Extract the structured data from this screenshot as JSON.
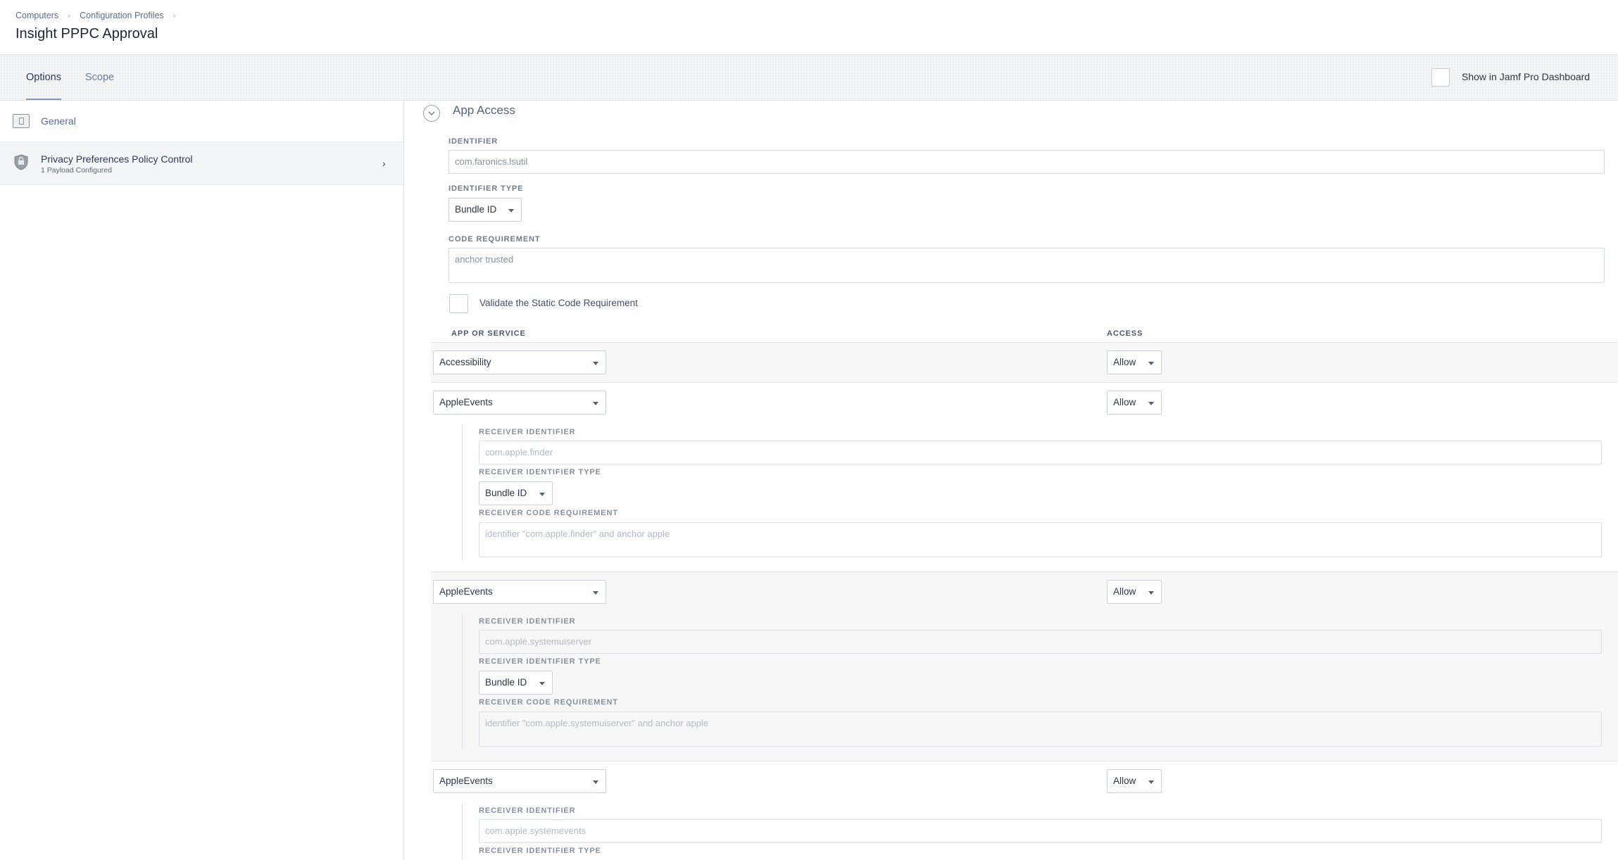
{
  "breadcrumb": [
    "Computers",
    "Configuration Profiles"
  ],
  "page_title": "Insight PPPC Approval",
  "tabs": {
    "options": "Options",
    "scope": "Scope"
  },
  "dashboard_label": "Show in Jamf Pro Dashboard",
  "sidebar": {
    "general": "General",
    "pppc": {
      "label": "Privacy Preferences Policy Control",
      "sub": "1 Payload Configured"
    }
  },
  "section": {
    "title": "App Access",
    "identifier_label": "IDENTIFIER",
    "identifier_value": "com.faronics.lsutil",
    "identifier_type_label": "IDENTIFIER TYPE",
    "identifier_type_value": "Bundle ID",
    "code_req_label": "CODE REQUIREMENT",
    "code_req_value": "anchor trusted",
    "validate_label": "Validate the Static Code Requirement",
    "col_app": "APP OR SERVICE",
    "col_access": "ACCESS"
  },
  "receiver_labels": {
    "identifier": "RECEIVER IDENTIFIER",
    "type": "RECEIVER IDENTIFIER TYPE",
    "code": "RECEIVER CODE REQUIREMENT"
  },
  "rows": [
    {
      "service": "Accessibility",
      "access": "Allow"
    },
    {
      "service": "AppleEvents",
      "access": "Allow",
      "receiver_id": "com.apple.finder",
      "receiver_type": "Bundle ID",
      "receiver_code": "identifier \"com.apple.finder\" and anchor apple"
    },
    {
      "service": "AppleEvents",
      "access": "Allow",
      "receiver_id": "com.apple.systemuiserver",
      "receiver_type": "Bundle ID",
      "receiver_code": "identifier \"com.apple.systemuiserver\" and anchor apple"
    },
    {
      "service": "AppleEvents",
      "access": "Allow",
      "receiver_id": "com.apple.systemevents"
    }
  ]
}
